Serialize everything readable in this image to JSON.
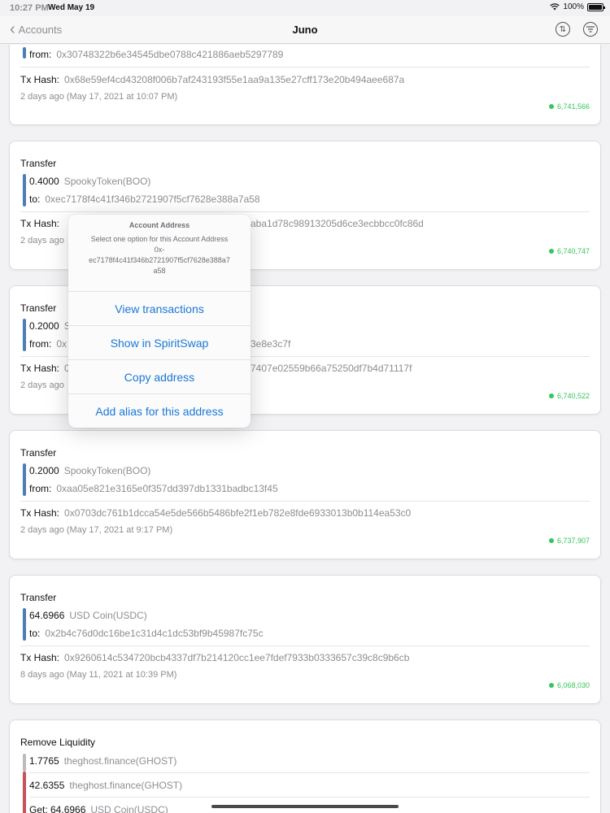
{
  "status": {
    "time": "10:27 PM",
    "date": "Wed May 19",
    "battery": "100%"
  },
  "nav": {
    "back_label": "Accounts",
    "title": "Juno",
    "sort_icon": "swap-arrows-icon",
    "filter_icon": "filter-lines-icon"
  },
  "cards": [
    {
      "from_label": "from:",
      "from_value": "0x30748322b6e34545dbe0788c421886aeb5297789",
      "tx_label": "Tx Hash:",
      "tx_value": "0x68e59ef4cd43208f006b7af243193f55e1aa9a135e27cff173e20b494aee687a",
      "time": "2 days ago (May 17, 2021 at 10:07 PM)",
      "block": "6,741,566"
    },
    {
      "title": "Transfer",
      "amount": "0.4000",
      "token": "SpookyToken(BOO)",
      "addr_label": "to:",
      "addr_value": "0xec7178f4c41f346b2721907f5cf7628e388a7a58",
      "tx_label": "Tx Hash:",
      "tx_value": "aba1d78c98913205d6ce3ecbbcc0fc86d",
      "time": "2 days ago",
      "block": "6,740,747"
    },
    {
      "title": "Transfer",
      "amount": "0.2000",
      "token": "S",
      "addr_label": "from:",
      "addr_value": "0x",
      "addr_tail": "3e8e3c7f",
      "tx_label": "Tx Hash:",
      "tx_value": "0",
      "tx_tail": "7407e02559b66a75250df7b4d71117f",
      "time": "2 days ago",
      "block": "6,740,522"
    },
    {
      "title": "Transfer",
      "amount": "0.2000",
      "token": "SpookyToken(BOO)",
      "addr_label": "from:",
      "addr_value": "0xaa05e821e3165e0f357dd397db1331badbc13f45",
      "tx_label": "Tx Hash:",
      "tx_value": "0x0703dc761b1dcca54e5de566b5486bfe2f1eb782e8fde6933013b0b114ea53c0",
      "time": "2 days ago (May 17, 2021 at 9:17 PM)",
      "block": "6,737,907"
    },
    {
      "title": "Transfer",
      "amount": "64.6966",
      "token": "USD Coin(USDC)",
      "addr_label": "to:",
      "addr_value": "0x2b4c76d0dc16be1c31d4c1dc53bf9b45987fc75c",
      "tx_label": "Tx Hash:",
      "tx_value": "0x9260614c534720bcb4337df7b214120cc1ee7fdef7933b0333657c39c8c9b6cb",
      "time": "8 days ago (May 11, 2021 at 10:39 PM)",
      "block": "6,068,030"
    },
    {
      "title": "Remove Liquidity",
      "lines": [
        {
          "amount": "1.7765",
          "token": "theghost.finance(GHOST)"
        },
        {
          "amount": "42.6355",
          "token": "theghost.finance(GHOST)"
        },
        {
          "amount": "Get: 64.6966",
          "token": "USD Coin(USDC)"
        }
      ]
    }
  ],
  "popover": {
    "title": "Account Address",
    "message": "Select one option for this Account Address",
    "address": "0x-\nec7178f4c41f346b2721907f5cf7628e388a7\na58",
    "items": [
      "View transactions",
      "Show in SpiritSwap",
      "Copy address",
      "Add alias for this address"
    ]
  }
}
